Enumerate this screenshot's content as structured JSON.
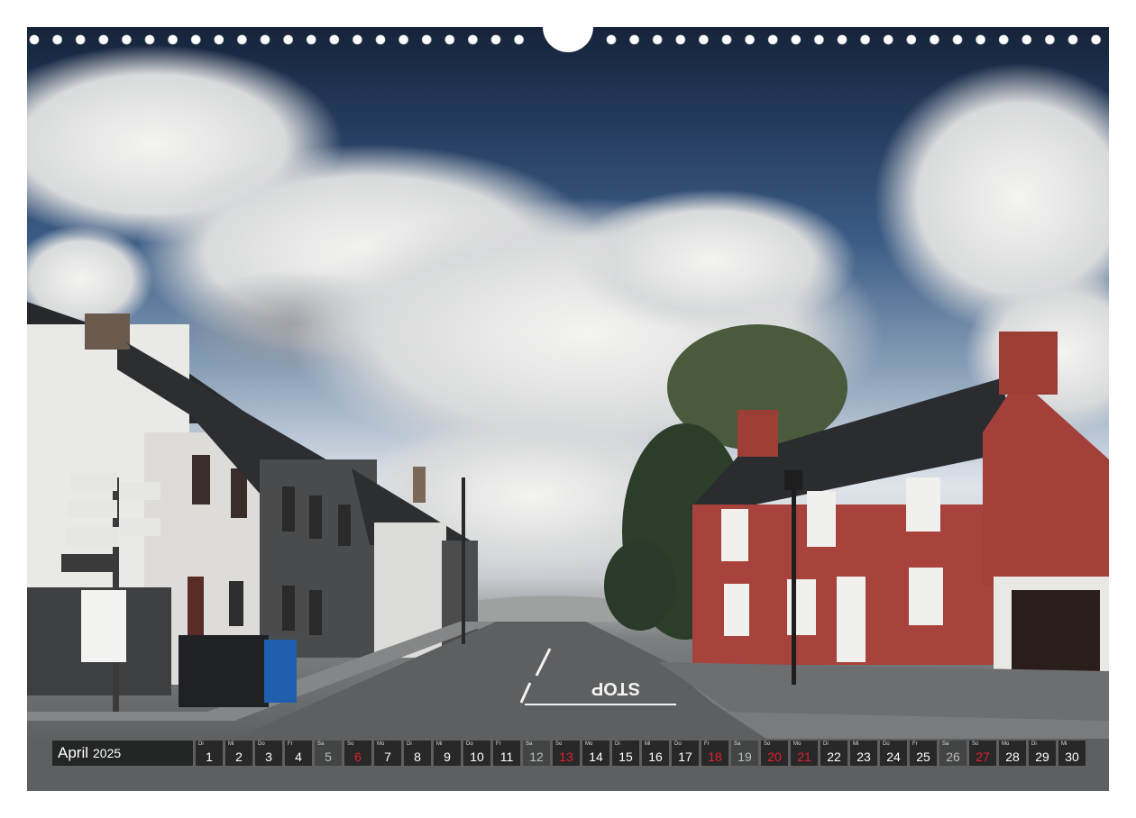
{
  "calendar": {
    "month": "April",
    "year": "2025",
    "days": [
      {
        "wd": "Di",
        "n": "1",
        "type": "weekday"
      },
      {
        "wd": "Mi",
        "n": "2",
        "type": "weekday"
      },
      {
        "wd": "Do",
        "n": "3",
        "type": "weekday"
      },
      {
        "wd": "Fr",
        "n": "4",
        "type": "weekday"
      },
      {
        "wd": "Sa",
        "n": "5",
        "type": "sat"
      },
      {
        "wd": "So",
        "n": "6",
        "type": "sun"
      },
      {
        "wd": "Mo",
        "n": "7",
        "type": "weekday"
      },
      {
        "wd": "Di",
        "n": "8",
        "type": "weekday"
      },
      {
        "wd": "Mi",
        "n": "9",
        "type": "weekday"
      },
      {
        "wd": "Do",
        "n": "10",
        "type": "weekday"
      },
      {
        "wd": "Fr",
        "n": "11",
        "type": "weekday"
      },
      {
        "wd": "Sa",
        "n": "12",
        "type": "sat"
      },
      {
        "wd": "So",
        "n": "13",
        "type": "sun"
      },
      {
        "wd": "Mo",
        "n": "14",
        "type": "weekday"
      },
      {
        "wd": "Di",
        "n": "15",
        "type": "weekday"
      },
      {
        "wd": "Mi",
        "n": "16",
        "type": "weekday"
      },
      {
        "wd": "Do",
        "n": "17",
        "type": "weekday"
      },
      {
        "wd": "Fr",
        "n": "18",
        "type": "hol"
      },
      {
        "wd": "Sa",
        "n": "19",
        "type": "sat"
      },
      {
        "wd": "So",
        "n": "20",
        "type": "sun"
      },
      {
        "wd": "Mo",
        "n": "21",
        "type": "hol"
      },
      {
        "wd": "Di",
        "n": "22",
        "type": "weekday"
      },
      {
        "wd": "Mi",
        "n": "23",
        "type": "weekday"
      },
      {
        "wd": "Do",
        "n": "24",
        "type": "weekday"
      },
      {
        "wd": "Fr",
        "n": "25",
        "type": "weekday"
      },
      {
        "wd": "Sa",
        "n": "26",
        "type": "sat"
      },
      {
        "wd": "So",
        "n": "27",
        "type": "sun"
      },
      {
        "wd": "Mo",
        "n": "28",
        "type": "weekday"
      },
      {
        "wd": "Di",
        "n": "29",
        "type": "weekday"
      },
      {
        "wd": "Mi",
        "n": "30",
        "type": "weekday"
      }
    ]
  },
  "photo": {
    "road_marking": "STOP",
    "colors": {
      "red_house": "#a8423c",
      "sky_dark": "#1c2c48",
      "road": "#5e5f60"
    }
  }
}
